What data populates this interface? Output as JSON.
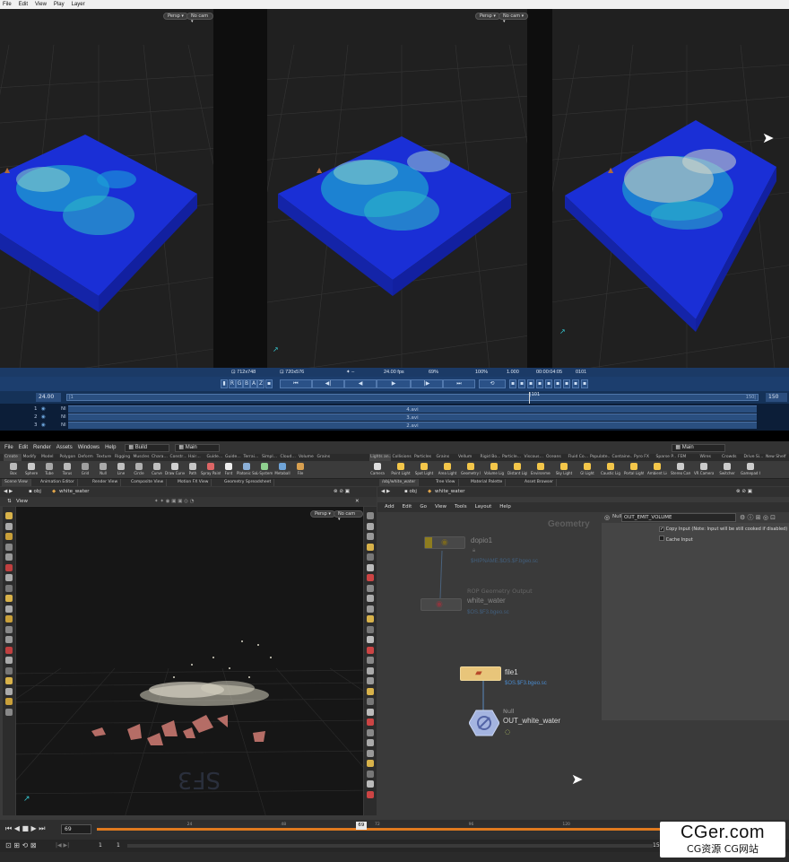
{
  "top_app": {
    "menu": [
      "File",
      "Edit",
      "View",
      "Play",
      "Layer"
    ],
    "viewport_chips": {
      "persp": "Persp ▾",
      "cam": "No cam ▾"
    },
    "status": {
      "res1": "⊡ 712x748",
      "res2": "⊡ 720x576",
      "fps": "24.00 fps",
      "zoom": "69%",
      "pct": "100%",
      "gamma": "1.000",
      "timecode": "00:00:04:05",
      "frame": "0101"
    },
    "channels": [
      "R",
      "G",
      "B",
      "A",
      "Z"
    ],
    "timeline": {
      "start_fps": "24.00",
      "end_frame": "150",
      "slider_start": "|1",
      "slider_end": "150|",
      "marker": "|101",
      "fraction": 0.667
    },
    "layers": [
      {
        "num": "1",
        "name": "Nl",
        "label": "4.avi"
      },
      {
        "num": "2",
        "name": "Nl",
        "label": "3.avi"
      },
      {
        "num": "3",
        "name": "Nl",
        "label": "2.avi"
      }
    ]
  },
  "houdini": {
    "menu": [
      "File",
      "Edit",
      "Render",
      "Assets",
      "Windows",
      "Help"
    ],
    "desktop": "Build",
    "context": "Main",
    "right_context": "Main",
    "shelf_tabs_left": [
      "Create",
      "Modify",
      "Model",
      "Polygon",
      "Deform",
      "Texture",
      "Rigging",
      "Muscles",
      "Chara…",
      "Constr…",
      "Hair…",
      "Guide…",
      "Guide…",
      "Terrai…",
      "Simpl…",
      "Cloud…",
      "Volume",
      "Grains"
    ],
    "shelf_tabs_right": [
      "Lights an…",
      "Collisions",
      "Particles",
      "Grains",
      "Vellum",
      "Rigid Bo…",
      "Particle…",
      "Viscous…",
      "Oceans",
      "Fluid Co…",
      "Populate…",
      "Containe…",
      "Pyro FX",
      "Sparse P…",
      "FEM",
      "Wires",
      "Crowds",
      "Drive Si…",
      "New Shelf"
    ],
    "tools_left": [
      "Box",
      "Sphere",
      "Tube",
      "Torus",
      "Grid",
      "Null",
      "Line",
      "Circle",
      "Curve",
      "Draw Curve",
      "Path",
      "Spray Paint",
      "Font",
      "Platonic Solids",
      "L-System",
      "Metaball",
      "File"
    ],
    "tools_right": [
      "Camera",
      "Point Light",
      "Spot Light",
      "Area Light",
      "Geometry Light",
      "Volume Light",
      "Distant Light",
      "Environment Light",
      "Sky Light",
      "GI Light",
      "Caustic Light",
      "Portal Light",
      "Ambient Light",
      "Stereo Camera",
      "VR Camera",
      "Switcher",
      "Gamepad Camera"
    ],
    "panel_tabs_left": [
      "Scene View",
      "Animation Editor",
      "Render View",
      "Composite View",
      "Motion FX View",
      "Geometry Spreadsheet"
    ],
    "panel_tabs_right": [
      "/obj/white_water",
      "Tree View",
      "Material Palette",
      "Asset Browser"
    ],
    "path_left": {
      "obj": "obj",
      "node": "white_water"
    },
    "path_right": {
      "obj": "obj",
      "node": "white_water"
    },
    "scene_view_title": "View",
    "viewport_chips": {
      "persp": "Persp ▾",
      "cam": "No cam ▾"
    },
    "ne_menu": [
      "Add",
      "Edit",
      "Go",
      "View",
      "Tools",
      "Layout",
      "Help"
    ],
    "ne_context": "Geometry",
    "nodes": {
      "dopio": {
        "name": "dopio1",
        "path": "$HIPNAME.$OS.$F.bgeo.sc"
      },
      "rop": {
        "type": "ROP Geometry Output",
        "name": "white_water",
        "path": "$OS.$F3.bgeo.sc"
      },
      "file": {
        "name": "file1",
        "path": "$OS.$F3.bgeo.sc"
      },
      "null": {
        "type": "Null",
        "name": "OUT_white_water"
      }
    },
    "params": {
      "node_type": "Null",
      "node_name": "OUT_EMIT_VOLUME",
      "copy_input": "Copy Input (Note: Input will be still cooked if disabled)",
      "cache_input": "Cache Input"
    },
    "playbar": {
      "frame": "69",
      "marker": "69",
      "ticks": [
        "24",
        "48",
        "72",
        "96",
        "120"
      ],
      "fraction": 0.46
    },
    "range": {
      "start": "1",
      "start2": "1",
      "end": "150"
    }
  },
  "watermark": {
    "main": "CGer.com",
    "sub": "CG资源  CG网站"
  }
}
